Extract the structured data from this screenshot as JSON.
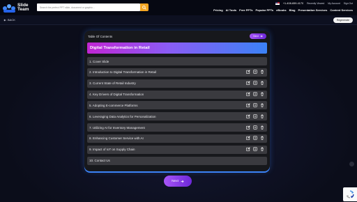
{
  "header": {
    "logo_line1": "Slide",
    "logo_line2": "Team",
    "search_placeholder": "Search the perfect PPT slide, document or graphic...",
    "phone": "+1-408-659-4170",
    "util_links": [
      "Recently Viewed",
      "My Account",
      "Sign Out"
    ],
    "nav": [
      "Pricing",
      "AI Tools",
      "Free PPTs",
      "Popular PPTs",
      "eBooks",
      "Blog",
      "Presentation Services",
      "Content Services"
    ]
  },
  "subbar": {
    "back_label": "BACK",
    "regenerate_label": "Regenerate"
  },
  "card": {
    "toc_title": "Table Of Contents",
    "next_small_label": "Next",
    "banner_title": "Digital Transformation in Retail",
    "rows": [
      {
        "label": "1. Cover Slide",
        "icons": false
      },
      {
        "label": "2. Introduction to Digital Transformation in Retail",
        "icons": true
      },
      {
        "label": "3. Current State of Retail Industry",
        "icons": true
      },
      {
        "label": "4. Key Drivers of Digital Transformation",
        "icons": true
      },
      {
        "label": "5. Adopting E-commerce Platforms",
        "icons": true
      },
      {
        "label": "6. Leveraging Data Analytics for Personalization",
        "icons": true
      },
      {
        "label": "7. Utilizing AI for Inventory Management",
        "icons": true
      },
      {
        "label": "8. Enhancing Customer Service with AI",
        "icons": true
      },
      {
        "label": "9. Impact of IoT on Supply Chain",
        "icons": true
      },
      {
        "label": "10. Contact Us",
        "icons": false
      }
    ]
  },
  "footer": {
    "next_label": "Next"
  },
  "colors": {
    "accent_purple": "#a855f7",
    "accent_blue": "#3b82f6",
    "search_orange": "#f5a623"
  }
}
